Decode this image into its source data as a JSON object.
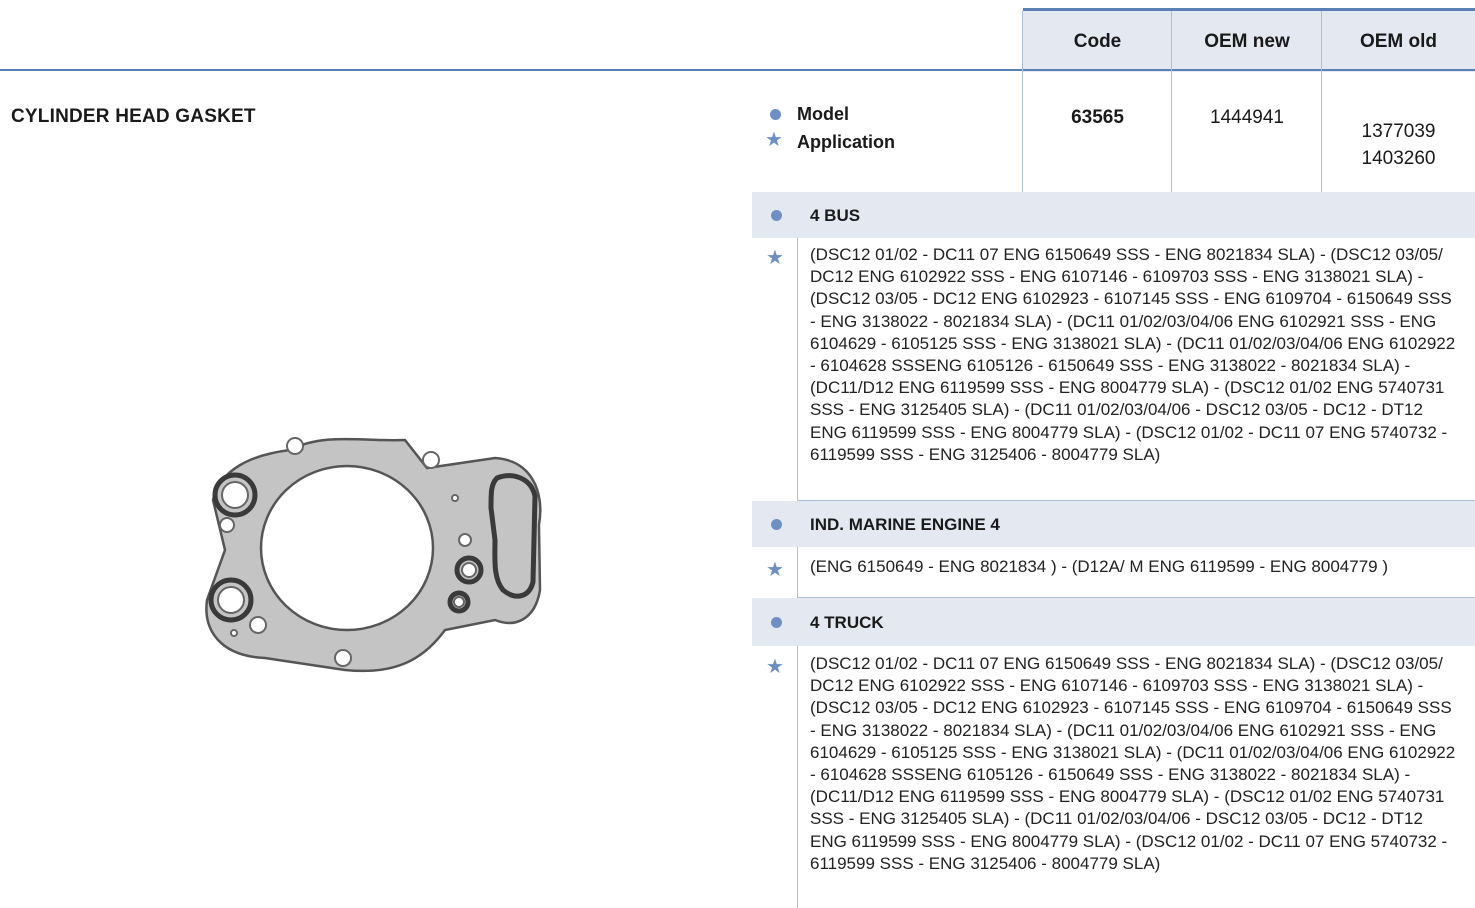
{
  "header": {
    "code_label": "Code",
    "oem_new_label": "OEM new",
    "oem_old_label": "OEM old"
  },
  "product": {
    "title": "CYLINDER HEAD GASKET",
    "legend": {
      "model_label": "Model",
      "application_label": "Application"
    },
    "code": "63565",
    "oem_new": "1444941",
    "oem_old": [
      "1377039",
      "1403260"
    ]
  },
  "sections": [
    {
      "model": "4 BUS",
      "application": "(DSC12 01/02 - DC11 07 ENG 6150649 SSS - ENG 8021834 SLA) - (DSC12 03/05/ DC12 ENG 6102922 SSS - ENG 6107146 - 6109703 SSS - ENG 3138021 SLA) - (DSC12 03/05 - DC12 ENG 6102923 - 6107145 SSS - ENG 6109704 - 6150649 SSS - ENG 3138022 - 8021834 SLA) - (DC11 01/02/03/04/06 ENG 6102921 SSS - ENG 6104629 - 6105125 SSS - ENG 3138021 SLA) - (DC11 01/02/03/04/06 ENG 6102922 - 6104628 SSSENG 6105126 - 6150649 SSS - ENG 3138022 - 8021834 SLA) - (DC11/D12 ENG 6119599 SSS - ENG 8004779 SLA) - (DSC12 01/02 ENG 5740731 SSS - ENG 3125405 SLA) - (DC11 01/02/03/04/06 - DSC12 03/05 - DC12 - DT12 ENG 6119599 SSS - ENG 8004779 SLA) - (DSC12 01/02 - DC11 07 ENG 5740732 - 6119599 SSS - ENG 3125406 - 8004779 SLA)"
    },
    {
      "model": "IND. MARINE ENGINE 4",
      "application": "(ENG 6150649 - ENG 8021834 ) - (D12A/ M ENG 6119599 - ENG 8004779 )"
    },
    {
      "model": "4 TRUCK",
      "application": "(DSC12 01/02 - DC11 07 ENG 6150649 SSS - ENG 8021834 SLA) - (DSC12 03/05/ DC12 ENG 6102922 SSS - ENG 6107146 - 6109703 SSS - ENG 3138021 SLA) - (DSC12 03/05 - DC12 ENG 6102923 - 6107145 SSS - ENG 6109704 - 6150649 SSS - ENG 3138022 - 8021834 SLA) - (DC11 01/02/03/04/06 ENG 6102921 SSS - ENG 6104629 - 6105125 SSS - ENG 3138021 SLA) - (DC11 01/02/03/04/06 ENG 6102922 - 6104628 SSSENG 6105126 - 6150649 SSS - ENG 3138022 - 8021834 SLA) - (DC11/D12 ENG 6119599 SSS - ENG 8004779 SLA) - (DSC12 01/02 ENG 5740731 SSS - ENG 3125405 SLA) - (DC11 01/02/03/04/06 - DSC12 03/05 - DC12 - DT12 ENG 6119599 SSS - ENG 8004779 SLA) - (DSC12 01/02 - DC11 07 ENG 5740732 - 6119599 SSS - ENG 3125406 - 8004779 SLA)"
    }
  ],
  "colors": {
    "accent": "#5b80b5",
    "bullet": "#6e8fc4",
    "band": "#e3e8f1",
    "divider": "#aebed6"
  },
  "icons": {
    "model": "circle-bullet-icon",
    "application": "star-icon"
  }
}
